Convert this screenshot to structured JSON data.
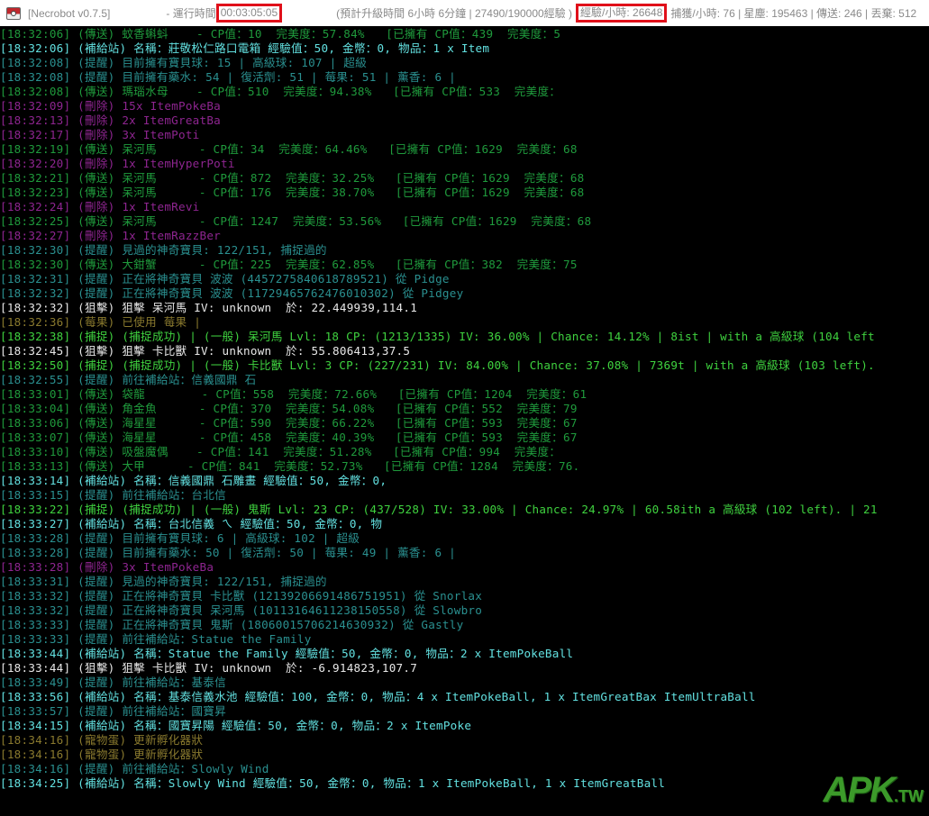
{
  "titlebar": {
    "app_title": "[Necrobot v0.7.5]",
    "runtime_label": "- 運行時間",
    "runtime": "00:03:05:05",
    "levelup_info": "(預計升級時間 6小時 6分鐘 | 27490/190000經驗 )",
    "xp_per_hour": "經驗/小時: 26648",
    "stats": "捕獲/小時: 76 | 星塵: 195463 | 傳送: 246 | 丟棄: 512"
  },
  "colors": {
    "transfer": "#1f9a3c",
    "pokestop": "#62e0e0",
    "info": "#2a9090",
    "recycle": "#8e2590",
    "snipe": "#e8e8e8",
    "berry": "#8a7a2e",
    "catch": "#3fd23f",
    "highlight": "#e0101a"
  },
  "log": [
    {
      "kind": "transfer",
      "text": "[18:32:06] (傳送) 蚊香蝌蚪    - CP值：10  完美度：57.84%   [已擁有 CP值：439  完美度：5"
    },
    {
      "kind": "pokestop",
      "text": "[18:32:06] (補給站) 名稱：莊敬松仁路口電箱 經驗值：50, 金幣：0, 物品：1 x Item"
    },
    {
      "kind": "info",
      "text": "[18:32:08] (提醒) 目前擁有寶貝球: 15 | 高級球: 107 | 超級"
    },
    {
      "kind": "info",
      "text": "[18:32:08] (提醒) 目前擁有藥水: 54 | 復活劑: 51 | 莓果: 51 | 薰香: 6 |"
    },
    {
      "kind": "transfer",
      "text": "[18:32:08] (傳送) 瑪瑙水母    - CP值：510  完美度：94.38%   [已擁有 CP值：533  完美度："
    },
    {
      "kind": "recycle",
      "text": "[18:32:09] (刪除) 15x ItemPokeBa"
    },
    {
      "kind": "recycle",
      "text": "[18:32:13] (刪除) 2x ItemGreatBa"
    },
    {
      "kind": "recycle",
      "text": "[18:32:17] (刪除) 3x ItemPoti"
    },
    {
      "kind": "transfer",
      "text": "[18:32:19] (傳送) 呆河馬      - CP值：34  完美度：64.46%   [已擁有 CP值：1629  完美度：68"
    },
    {
      "kind": "recycle",
      "text": "[18:32:20] (刪除) 1x ItemHyperPoti"
    },
    {
      "kind": "transfer",
      "text": "[18:32:21] (傳送) 呆河馬      - CP值：872  完美度：32.25%   [已擁有 CP值：1629  完美度：68"
    },
    {
      "kind": "transfer",
      "text": "[18:32:23] (傳送) 呆河馬      - CP值：176  完美度：38.70%   [已擁有 CP值：1629  完美度：68"
    },
    {
      "kind": "recycle",
      "text": "[18:32:24] (刪除) 1x ItemRevi"
    },
    {
      "kind": "transfer",
      "text": "[18:32:25] (傳送) 呆河馬      - CP值：1247  完美度：53.56%   [已擁有 CP值：1629  完美度：68"
    },
    {
      "kind": "recycle",
      "text": "[18:32:27] (刪除) 1x ItemRazzBer"
    },
    {
      "kind": "info",
      "text": "[18:32:30] (提醒) 見過的神奇寶貝: 122/151, 捕捉過的"
    },
    {
      "kind": "transfer",
      "text": "[18:32:30] (傳送) 大鉗蟹      - CP值：225  完美度：62.85%   [已擁有 CP值：382  完美度：75"
    },
    {
      "kind": "info",
      "text": "[18:32:31] (提醒) 正在將神奇寶貝 波波 (4457275840618789521) 從 Pidge"
    },
    {
      "kind": "info",
      "text": "[18:32:32] (提醒) 正在將神奇寶貝 波波 (11729465762476010302) 從 Pidgey"
    },
    {
      "kind": "snipe",
      "text": "[18:32:32] (狙擊) 狙擊 呆河馬 IV: unknown  於: 22.449939,114.1"
    },
    {
      "kind": "berry",
      "text": "[18:32:36] (莓果) 已使用 莓果 |"
    },
    {
      "kind": "catch",
      "text": "[18:32:38] (捕捉) (捕捉成功) | (一般) 呆河馬 Lvl: 18 CP: (1213/1335) IV: 36.00% | Chance: 14.12% | 8ist | with a 高級球 (104 left"
    },
    {
      "kind": "snipe",
      "text": "[18:32:45] (狙擊) 狙擊 卡比獸 IV: unknown  於: 55.806413,37.5"
    },
    {
      "kind": "catch",
      "text": "[18:32:50] (捕捉) (捕捉成功) | (一般) 卡比獸 Lvl: 3 CP: (227/231) IV: 84.00% | Chance: 37.08% | 7369t | with a 高級球 (103 left)."
    },
    {
      "kind": "info",
      "text": "[18:32:55] (提醒) 前往補給站：信義國鼎 石"
    },
    {
      "kind": "transfer",
      "text": "[18:33:01] (傳送) 袋龍        - CP值：558  完美度：72.66%   [已擁有 CP值：1204  完美度：61"
    },
    {
      "kind": "transfer",
      "text": "[18:33:04] (傳送) 角金魚      - CP值：370  完美度：54.08%   [已擁有 CP值：552  完美度：79"
    },
    {
      "kind": "transfer",
      "text": "[18:33:06] (傳送) 海星星      - CP值：590  完美度：66.22%   [已擁有 CP值：593  完美度：67"
    },
    {
      "kind": "transfer",
      "text": "[18:33:07] (傳送) 海星星      - CP值：458  完美度：40.39%   [已擁有 CP值：593  完美度：67"
    },
    {
      "kind": "transfer",
      "text": "[18:33:10] (傳送) 吸盤魔偶    - CP值：141  完美度：51.28%   [已擁有 CP值：994  完美度："
    },
    {
      "kind": "transfer",
      "text": "[18:33:13] (傳送) 大甲      - CP值：841  完美度：52.73%   [已擁有 CP值：1284  完美度：76."
    },
    {
      "kind": "pokestop",
      "text": "[18:33:14] (補給站) 名稱：信義國鼎 石雕畫 經驗值：50, 金幣：0,"
    },
    {
      "kind": "info",
      "text": "[18:33:15] (提醒) 前往補給站：台北信"
    },
    {
      "kind": "catch",
      "text": "[18:33:22] (捕捉) (捕捉成功) | (一般) 鬼斯 Lvl: 23 CP: (437/528) IV: 33.00% | Chance: 24.97% | 60.58ith a 高級球 (102 left). | 21"
    },
    {
      "kind": "pokestop",
      "text": "[18:33:27] (補給站) 名稱：台北信義 ㄟ 經驗值：50, 金幣：0, 物"
    },
    {
      "kind": "info",
      "text": "[18:33:28] (提醒) 目前擁有寶貝球: 6 | 高級球: 102 | 超級"
    },
    {
      "kind": "info",
      "text": "[18:33:28] (提醒) 目前擁有藥水: 50 | 復活劑: 50 | 莓果: 49 | 薰香: 6 |"
    },
    {
      "kind": "recycle",
      "text": "[18:33:28] (刪除) 3x ItemPokeBa"
    },
    {
      "kind": "info",
      "text": "[18:33:31] (提醒) 見過的神奇寶貝: 122/151, 捕捉過的"
    },
    {
      "kind": "info",
      "text": "[18:33:32] (提醒) 正在將神奇寶貝 卡比獸 (12139206691486751951) 從 Snorlax"
    },
    {
      "kind": "info",
      "text": "[18:33:32] (提醒) 正在將神奇寶貝 呆河馬 (10113164611238150558) 從 Slowbro"
    },
    {
      "kind": "info",
      "text": "[18:33:33] (提醒) 正在將神奇寶貝 鬼斯 (18060015706214630932) 從 Gastly"
    },
    {
      "kind": "info",
      "text": "[18:33:33] (提醒) 前往補給站：Statue the Family"
    },
    {
      "kind": "pokestop",
      "text": "[18:33:44] (補給站) 名稱：Statue the Family 經驗值：50, 金幣：0, 物品：2 x ItemPokeBall"
    },
    {
      "kind": "snipe",
      "text": "[18:33:44] (狙擊) 狙擊 卡比獸 IV: unknown  於: -6.914823,107.7"
    },
    {
      "kind": "info",
      "text": "[18:33:49] (提醒) 前往補給站：基泰信"
    },
    {
      "kind": "pokestop",
      "text": "[18:33:56] (補給站) 名稱：基泰信義水池 經驗值：100, 金幣：0, 物品：4 x ItemPokeBall, 1 x ItemGreatBax ItemUltraBall"
    },
    {
      "kind": "info",
      "text": "[18:33:57] (提醒) 前往補給站：國寶昇"
    },
    {
      "kind": "pokestop",
      "text": "[18:34:15] (補給站) 名稱：國寶昇陽 經驗值：50, 金幣：0, 物品：2 x ItemPoke"
    },
    {
      "kind": "egg",
      "text": "[18:34:16] (寵物蛋) 更新孵化器狀"
    },
    {
      "kind": "egg",
      "text": "[18:34:16] (寵物蛋) 更新孵化器狀"
    },
    {
      "kind": "info",
      "text": "[18:34:16] (提醒) 前往補給站：Slowly Wind"
    },
    {
      "kind": "pokestop",
      "text": "[18:34:25] (補給站) 名稱：Slowly Wind 經驗值：50, 金幣：0, 物品：1 x ItemPokeBall, 1 x ItemGreatBall"
    }
  ],
  "watermark": {
    "main": "APK",
    "suffix": ".TW"
  }
}
